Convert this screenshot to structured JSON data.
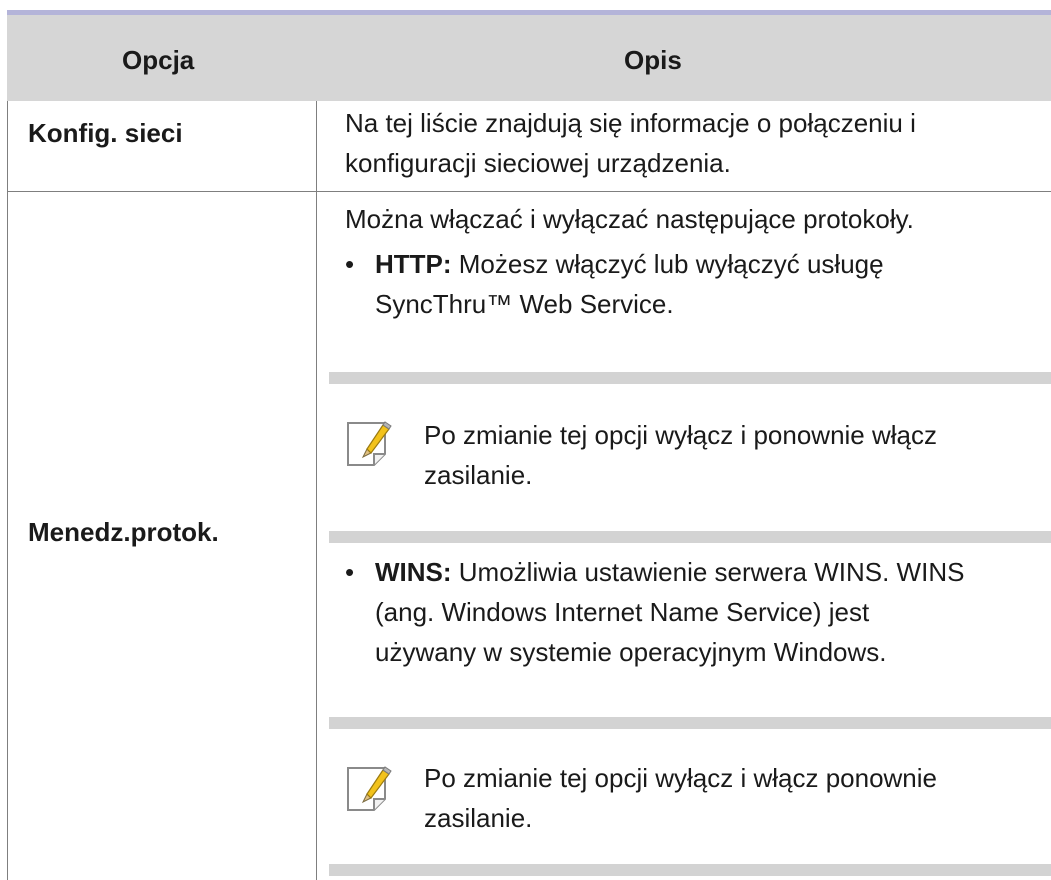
{
  "table": {
    "headers": {
      "option": "Opcja",
      "description": "Opis"
    },
    "rows": [
      {
        "option": "Konfig. sieci",
        "description_lines": [
          "Na tej liście znajdują się informacje o połączeniu i",
          "konfiguracji sieciowej urządzenia."
        ]
      },
      {
        "option": "Menedz.protok.",
        "intro": "Można włączać i wyłączać następujące protokoły.",
        "bullets": [
          {
            "marker": "•",
            "term": "HTTP:",
            "line1_rest": " Możesz włączyć lub wyłączyć usługę",
            "line2": "SyncThru™ Web Service.",
            "note_lines": [
              "Po zmianie tej opcji wyłącz i ponownie włącz",
              "zasilanie."
            ]
          },
          {
            "marker": "•",
            "term": "WINS:",
            "line1_rest": " Umożliwia ustawienie serwera WINS. WINS",
            "line2": "(ang. Windows Internet Name Service) jest",
            "line3": "używany w systemie operacyjnym Windows.",
            "note_lines": [
              "Po zmianie tej opcji wyłącz i włącz ponownie",
              "zasilanie."
            ]
          }
        ]
      }
    ]
  },
  "icons": {
    "note": "note-pencil-icon"
  },
  "colors": {
    "header_bg": "#d6d6d6",
    "top_rule": "#b4b4d9",
    "note_band": "#d3d3d3",
    "pencil_yellow": "#f2c21b"
  }
}
